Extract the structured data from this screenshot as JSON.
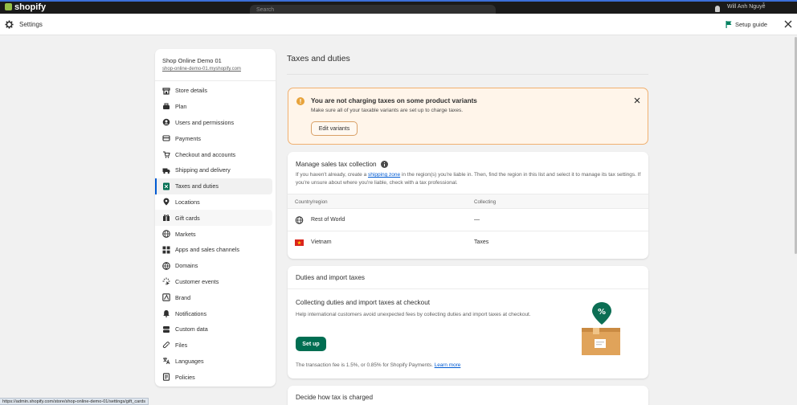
{
  "topbar": {
    "logo": "shopify",
    "search_placeholder": "Search",
    "store_label": "Will Anh Nguyễ"
  },
  "header": {
    "title": "Settings",
    "setup_guide": "Setup guide"
  },
  "sidebar": {
    "store_name": "Shop Online Demo 01",
    "store_url": "shop-online-demo-01.myshopify.com",
    "items": [
      {
        "label": "Store details",
        "icon": "store-icon"
      },
      {
        "label": "Plan",
        "icon": "plan-icon"
      },
      {
        "label": "Users and permissions",
        "icon": "user-icon"
      },
      {
        "label": "Payments",
        "icon": "payments-icon"
      },
      {
        "label": "Checkout and accounts",
        "icon": "checkout-icon"
      },
      {
        "label": "Shipping and delivery",
        "icon": "truck-icon"
      },
      {
        "label": "Taxes and duties",
        "icon": "tax-icon"
      },
      {
        "label": "Locations",
        "icon": "location-icon"
      },
      {
        "label": "Gift cards",
        "icon": "gift-icon"
      },
      {
        "label": "Markets",
        "icon": "globe-icon"
      },
      {
        "label": "Apps and sales channels",
        "icon": "apps-icon"
      },
      {
        "label": "Domains",
        "icon": "domains-icon"
      },
      {
        "label": "Customer events",
        "icon": "events-icon"
      },
      {
        "label": "Brand",
        "icon": "brand-icon"
      },
      {
        "label": "Notifications",
        "icon": "bell-icon"
      },
      {
        "label": "Custom data",
        "icon": "database-icon"
      },
      {
        "label": "Files",
        "icon": "paperclip-icon"
      },
      {
        "label": "Languages",
        "icon": "language-icon"
      },
      {
        "label": "Policies",
        "icon": "policy-icon"
      }
    ],
    "active_index": 6
  },
  "main": {
    "title": "Taxes and duties",
    "banner": {
      "title": "You are not charging taxes on some product variants",
      "subtitle": "Make sure all of your taxable variants are set up to charge taxes.",
      "button": "Edit variants"
    },
    "sales_tax": {
      "title": "Manage sales tax collection",
      "desc_before": "If you haven't already, create a ",
      "desc_link": "shipping zone",
      "desc_after": " in the region(s) you're liable in. Then, find the region in this list and select it to manage its tax settings. If you're unsure about where you're liable, check with a tax professional.",
      "col_region": "Country/region",
      "col_collecting": "Collecting",
      "rows": [
        {
          "region": "Rest of World",
          "collecting": "—",
          "icon": "globe-icon"
        },
        {
          "region": "Vietnam",
          "collecting": "Taxes",
          "icon": "vietnam-flag-icon"
        }
      ]
    },
    "duties": {
      "title": "Duties and import taxes",
      "subtitle": "Collecting duties and import taxes at checkout",
      "desc": "Help international customers avoid unexpected fees by collecting duties and import taxes at checkout.",
      "button": "Set up",
      "fee_text": "The transaction fee is 1.5%, or 0.85% for Shopify Payments. ",
      "fee_link": "Learn more"
    },
    "tax_charge": {
      "title": "Decide how tax is charged"
    }
  },
  "status_url": "https://admin.shopify.com/store/shop-online-demo-01/settings/gift_cards",
  "colors": {
    "accent_green": "#006e52",
    "link_blue": "#005bd3",
    "warning_orange": "#e8a33b",
    "banner_bg": "#fff5ea"
  }
}
